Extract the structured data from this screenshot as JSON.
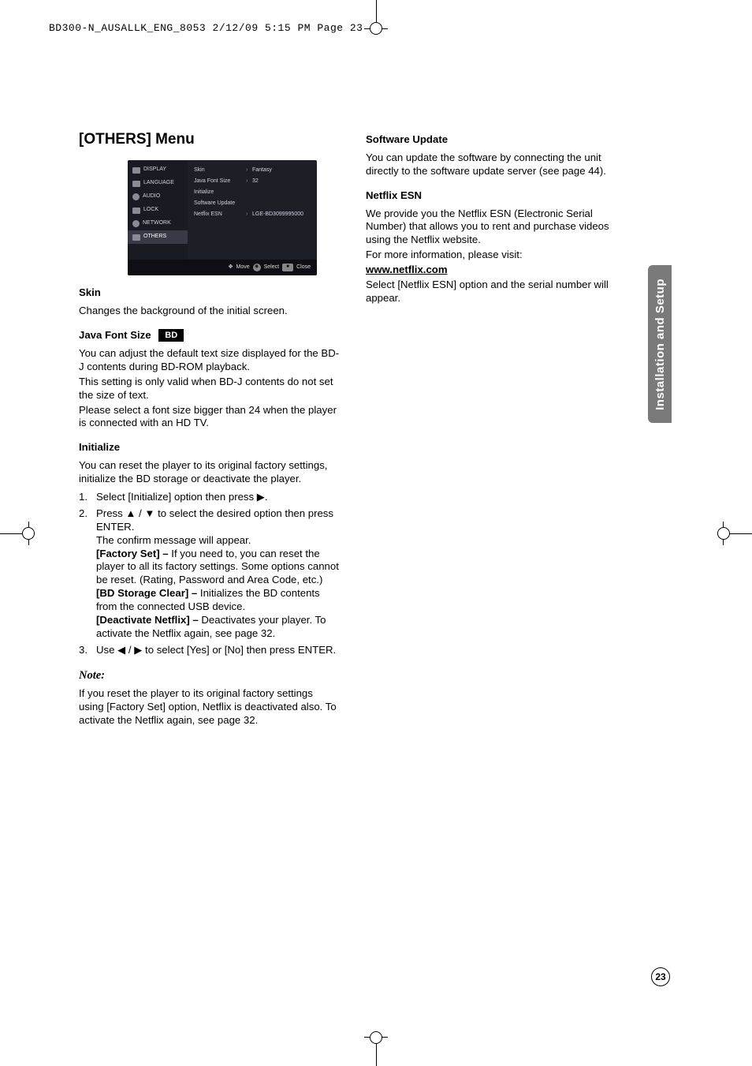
{
  "slug": "BD300-N_AUSALLK_ENG_8053  2/12/09  5:15 PM  Page 23",
  "side_tab": "Installation and Setup",
  "page_number": "23",
  "left": {
    "menu_title": "[OTHERS] Menu",
    "screenshot": {
      "sidebar": [
        {
          "label": "DISPLAY"
        },
        {
          "label": "LANGUAGE"
        },
        {
          "label": "AUDIO"
        },
        {
          "label": "LOCK"
        },
        {
          "label": "NETWORK"
        },
        {
          "label": "OTHERS"
        }
      ],
      "rows": [
        {
          "label": "Skin",
          "value": "Fantasy"
        },
        {
          "label": "Java Font Size",
          "value": "32"
        },
        {
          "label": "Initialize",
          "value": ""
        },
        {
          "label": "Software Update",
          "value": ""
        },
        {
          "label": "Netflix ESN",
          "value": "LGE-BD3099995000"
        }
      ],
      "bar": {
        "move": "Move",
        "select": "Select",
        "close": "Close"
      }
    },
    "skin_h": "Skin",
    "skin_p": "Changes the background of the initial screen.",
    "java_h": "Java Font Size",
    "bd_badge": "BD",
    "java_p1": "You can adjust the default text size displayed for the BD-J contents during BD-ROM playback.",
    "java_p2": "This setting is only valid when BD-J contents do not set the size of text.",
    "java_p3": "Please select a font size bigger than 24 when the player is connected with an HD TV.",
    "init_h": "Initialize",
    "init_p": "You can reset the player to its original factory settings, initialize the BD storage or deactivate the player.",
    "steps": {
      "s1": "Select [Initialize] option then press ▶.",
      "s2a": "Press ▲ / ▼ to select the desired option then press ENTER.",
      "s2b": "The confirm message will appear.",
      "s2c_label": "[Factory Set] – ",
      "s2c_text": "If you need to, you can reset the player to all its factory settings. Some options cannot be reset. (Rating, Password and Area Code, etc.)",
      "s2d_label": "[BD Storage Clear] – ",
      "s2d_text": "Initializes the BD contents from the connected USB device.",
      "s2e_label": "[Deactivate Netflix] – ",
      "s2e_text": "Deactivates your player. To activate the Netflix again, see page 32.",
      "s3": "Use ◀ / ▶ to select [Yes] or [No] then press ENTER."
    },
    "note_h": "Note:",
    "note_p": "If you reset the player to its original factory settings using [Factory Set] option, Netflix is deactivated also. To activate the Netflix again, see page 32."
  },
  "right": {
    "su_h": "Software Update",
    "su_p": "You can update the software by connecting the unit directly to the software update server (see page 44).",
    "esn_h": "Netflix ESN",
    "esn_p1": "We provide you the Netflix ESN (Electronic Serial Number) that allows you to rent and purchase videos using the Netflix website.",
    "esn_p2": "For more information, please visit:",
    "esn_link": "www.netflix.com",
    "esn_p3": "Select [Netflix ESN] option and the serial number will appear."
  }
}
